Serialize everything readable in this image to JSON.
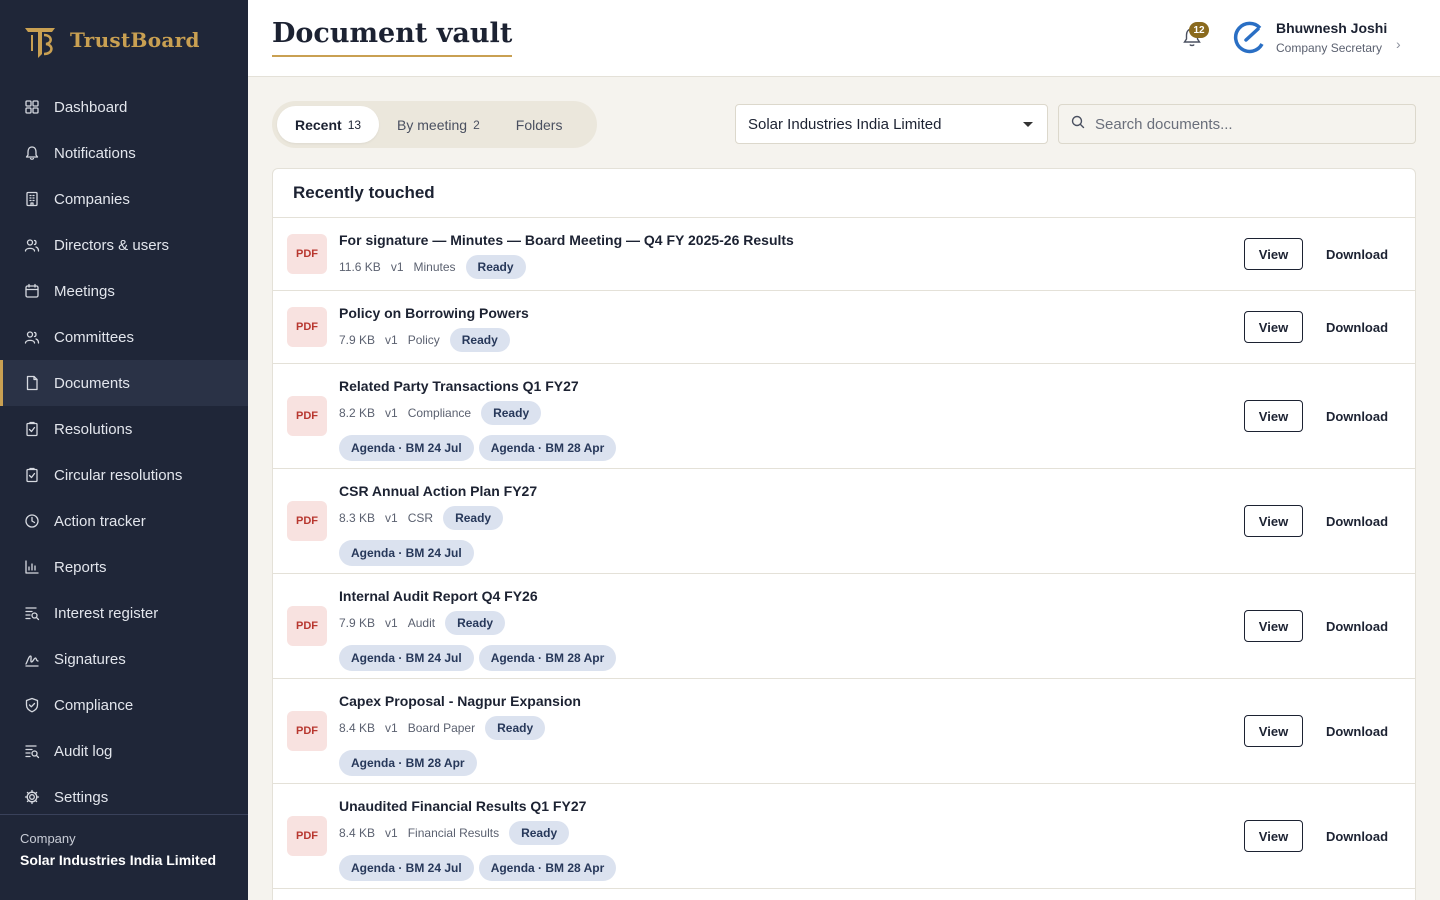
{
  "brand": {
    "name": "TrustBoard"
  },
  "sidebar": {
    "items": [
      {
        "label": "Dashboard",
        "icon": "grid-icon"
      },
      {
        "label": "Notifications",
        "icon": "bell-icon"
      },
      {
        "label": "Companies",
        "icon": "building-icon"
      },
      {
        "label": "Directors & users",
        "icon": "users-icon"
      },
      {
        "label": "Meetings",
        "icon": "calendar-icon"
      },
      {
        "label": "Committees",
        "icon": "users-icon"
      },
      {
        "label": "Documents",
        "icon": "document-icon",
        "active": true
      },
      {
        "label": "Resolutions",
        "icon": "clipboard-check-icon"
      },
      {
        "label": "Circular resolutions",
        "icon": "clipboard-check-icon"
      },
      {
        "label": "Action tracker",
        "icon": "clock-icon"
      },
      {
        "label": "Reports",
        "icon": "bar-chart-icon"
      },
      {
        "label": "Interest register",
        "icon": "list-search-icon"
      },
      {
        "label": "Signatures",
        "icon": "signature-icon"
      },
      {
        "label": "Compliance",
        "icon": "shield-check-icon"
      },
      {
        "label": "Audit log",
        "icon": "list-search-icon"
      },
      {
        "label": "Settings",
        "icon": "gear-icon"
      }
    ],
    "footer": {
      "label": "Company",
      "value": "Solar Industries India Limited"
    }
  },
  "header": {
    "title": "Document vault",
    "notifications_count": "12",
    "user": {
      "name": "Bhuwnesh Joshi",
      "role": "Company Secretary"
    }
  },
  "toolbar": {
    "tabs": [
      {
        "label": "Recent",
        "count": "13",
        "active": true
      },
      {
        "label": "By meeting",
        "count": "2"
      },
      {
        "label": "Folders",
        "count": ""
      }
    ],
    "company_select": "Solar Industries India Limited",
    "search_placeholder": "Search documents..."
  },
  "panel": {
    "title": "Recently touched",
    "view_label": "View",
    "download_label": "Download",
    "documents": [
      {
        "type": "PDF",
        "title": "For signature — Minutes — Board Meeting — Q4 FY 2025-26 Results",
        "size": "11.6 KB",
        "version": "v1",
        "category": "Minutes",
        "status": "Ready",
        "tags": []
      },
      {
        "type": "PDF",
        "title": "Policy on Borrowing Powers",
        "size": "7.9 KB",
        "version": "v1",
        "category": "Policy",
        "status": "Ready",
        "tags": []
      },
      {
        "type": "PDF",
        "title": "Related Party Transactions Q1 FY27",
        "size": "8.2 KB",
        "version": "v1",
        "category": "Compliance",
        "status": "Ready",
        "tags": [
          "Agenda · BM 24 Jul",
          "Agenda · BM 28 Apr"
        ]
      },
      {
        "type": "PDF",
        "title": "CSR Annual Action Plan FY27",
        "size": "8.3 KB",
        "version": "v1",
        "category": "CSR",
        "status": "Ready",
        "tags": [
          "Agenda · BM 24 Jul"
        ]
      },
      {
        "type": "PDF",
        "title": "Internal Audit Report Q4 FY26",
        "size": "7.9 KB",
        "version": "v1",
        "category": "Audit",
        "status": "Ready",
        "tags": [
          "Agenda · BM 24 Jul",
          "Agenda · BM 28 Apr"
        ]
      },
      {
        "type": "PDF",
        "title": "Capex Proposal - Nagpur Expansion",
        "size": "8.4 KB",
        "version": "v1",
        "category": "Board Paper",
        "status": "Ready",
        "tags": [
          "Agenda · BM 28 Apr"
        ]
      },
      {
        "type": "PDF",
        "title": "Unaudited Financial Results Q1 FY27",
        "size": "8.4 KB",
        "version": "v1",
        "category": "Financial Results",
        "status": "Ready",
        "tags": [
          "Agenda · BM 24 Jul",
          "Agenda · BM 28 Apr"
        ]
      }
    ]
  },
  "colors": {
    "sidebar_bg": "#1f2638",
    "accent_gold": "#c9a052",
    "pdf_red": "#b8372f",
    "pill_blue": "#dbe2ef"
  }
}
